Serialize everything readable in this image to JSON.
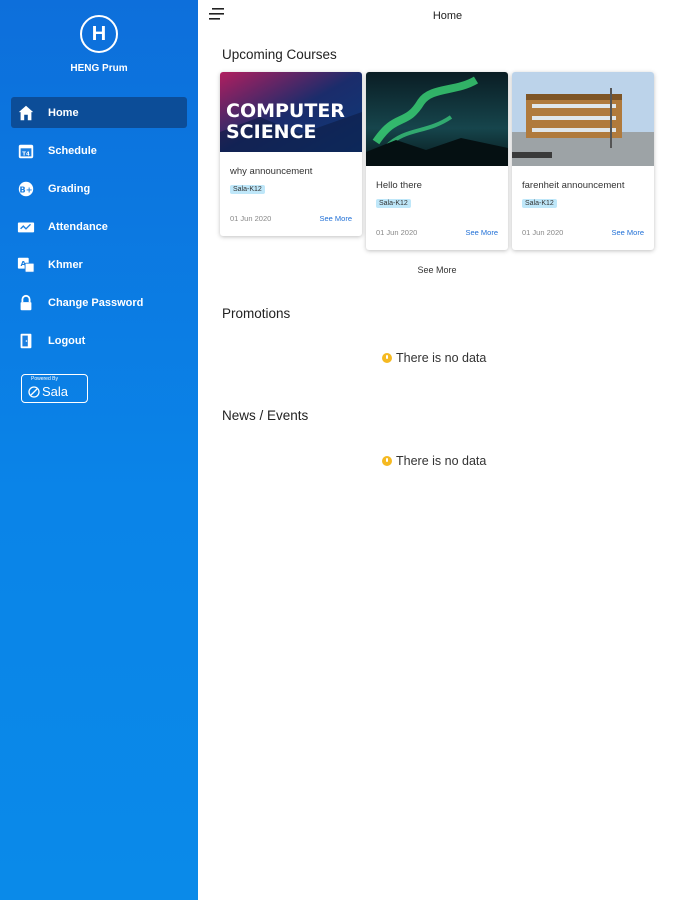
{
  "sidebar": {
    "avatar_letter": "H",
    "user_name": "HENG Prum",
    "items": [
      {
        "label": "Home",
        "icon": "home-icon",
        "active": true
      },
      {
        "label": "Schedule",
        "icon": "calendar-icon"
      },
      {
        "label": "Grading",
        "icon": "grading-icon"
      },
      {
        "label": "Attendance",
        "icon": "attendance-icon"
      },
      {
        "label": "Khmer",
        "icon": "language-icon"
      },
      {
        "label": "Change Password",
        "icon": "lock-icon"
      },
      {
        "label": "Logout",
        "icon": "logout-icon"
      }
    ],
    "powered_by": "Powered By",
    "brand": "Sala"
  },
  "header": {
    "title": "Home",
    "menu_icon": "menu-icon"
  },
  "upcoming": {
    "title": "Upcoming Courses",
    "see_more": "See More",
    "cards": [
      {
        "image_text_1": "COMPUTER",
        "image_text_2": "SCIENCE",
        "title": "why announcement",
        "tag": "Sala-K12",
        "date": "01 Jun 2020",
        "link": "See More"
      },
      {
        "title": "Hello there",
        "tag": "Sala-K12",
        "date": "01 Jun 2020",
        "link": "See More"
      },
      {
        "title": "farenheit announcement",
        "tag": "Sala-K12",
        "date": "01 Jun 2020",
        "link": "See More"
      }
    ]
  },
  "promotions": {
    "title": "Promotions",
    "empty": "There is no data"
  },
  "news": {
    "title": "News / Events",
    "empty": "There is no data"
  },
  "colors": {
    "sidebar": "#0d6fdb",
    "active": "#0c4d98",
    "tag_bg": "#bfe7f9",
    "link": "#1f6fd6",
    "warning": "#f5b921"
  }
}
